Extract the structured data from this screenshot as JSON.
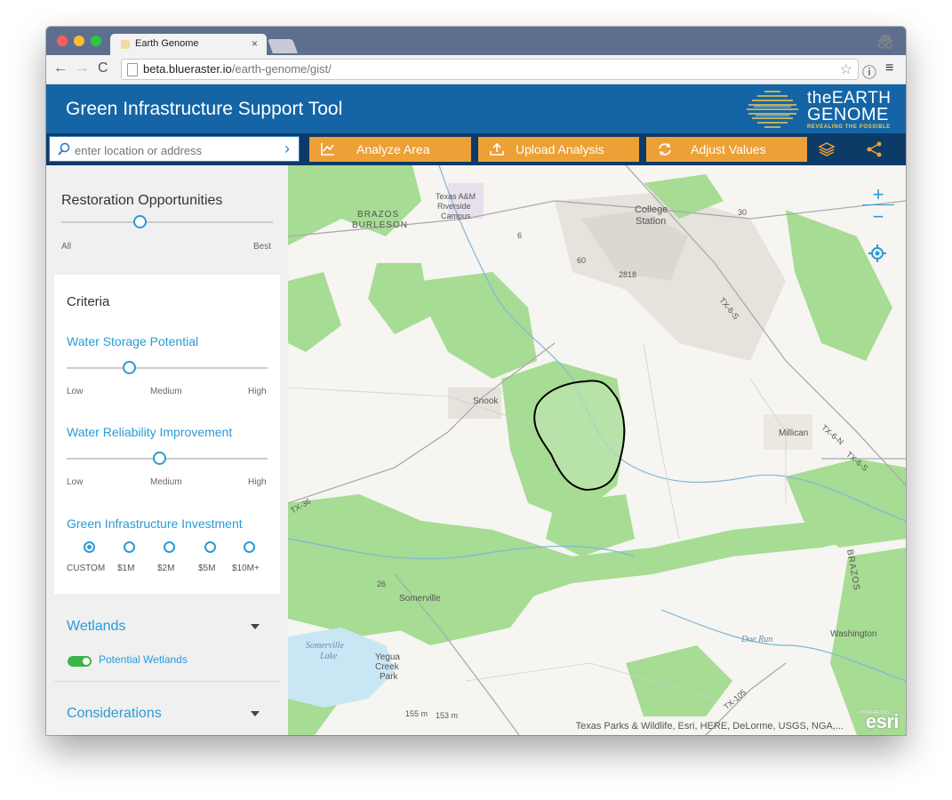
{
  "browser": {
    "tab_title": "Earth Genome",
    "tab_close": "×",
    "url_host": "beta.blueraster.io",
    "url_path": "/earth-genome/gist/"
  },
  "app": {
    "title": "Green Infrastructure Support Tool",
    "logo_line1": "theEARTH",
    "logo_line2": "GENOME",
    "logo_tagline": "REVEALING THE POSSIBLE"
  },
  "search": {
    "placeholder": "enter location or address"
  },
  "actions": {
    "analyze": "Analyze Area",
    "upload": "Upload Analysis",
    "adjust": "Adjust Values"
  },
  "sidebar": {
    "restoration": {
      "title": "Restoration Opportunities",
      "min_label": "All",
      "max_label": "Best",
      "value": 0.37
    },
    "criteria": {
      "title": "Criteria",
      "water_storage": {
        "label": "Water Storage Potential",
        "low": "Low",
        "mid": "Medium",
        "high": "High",
        "value": 0.31
      },
      "water_reliability": {
        "label": "Water Reliability Improvement",
        "low": "Low",
        "mid": "Medium",
        "high": "High",
        "value": 0.46
      },
      "investment": {
        "label": "Green Infrastructure Investment",
        "options": [
          "CUSTOM",
          "$1M",
          "$2M",
          "$5M",
          "$10M+"
        ],
        "selected": "CUSTOM"
      }
    },
    "wetlands": {
      "title": "Wetlands",
      "toggle_label": "Potential Wetlands",
      "toggle_on": true
    },
    "considerations": {
      "title": "Considerations"
    }
  },
  "map": {
    "labels": {
      "brazos": "BRAZOS",
      "burleson": "BURLESON",
      "tamu1": "Texas A&M",
      "tamu2": "Riverside",
      "tamu3": "Campus",
      "college1": "College",
      "college2": "Station",
      "snook": "Snook",
      "millican": "Millican",
      "somerville": "Somerville",
      "somerville_lake1": "Somerville",
      "somerville_lake2": "Lake",
      "yegua1": "Yegua",
      "yegua2": "Creek",
      "yegua3": "Park",
      "washington": "Washington",
      "doe_run": "Doe Run",
      "brazos_river": "BRAZOS",
      "tx6s": "TX-6-S",
      "tx6n": "TX-6-N",
      "tx6s2": "TX-6-S",
      "tx36": "TX-36",
      "tx105": "TX-105",
      "r30": "30",
      "r60": "60",
      "r2818": "2818",
      "r6": "6",
      "r26": "26",
      "elev1": "155 m",
      "elev2": "153 m"
    },
    "zoom_in": "+",
    "zoom_out": "−",
    "attribution": "Texas Parks & Wildlife, Esri, HERE, DeLorme, USGS, NGA,...",
    "esri_powered": "POWERED BY",
    "esri": "esri"
  },
  "colors": {
    "header_blue": "#1565a6",
    "action_navy": "#0d3b68",
    "button_orange": "#eda035",
    "accent_blue": "#2a9ad6",
    "vegetation_green": "#9bd88a",
    "toggle_green": "#3bb44a"
  }
}
